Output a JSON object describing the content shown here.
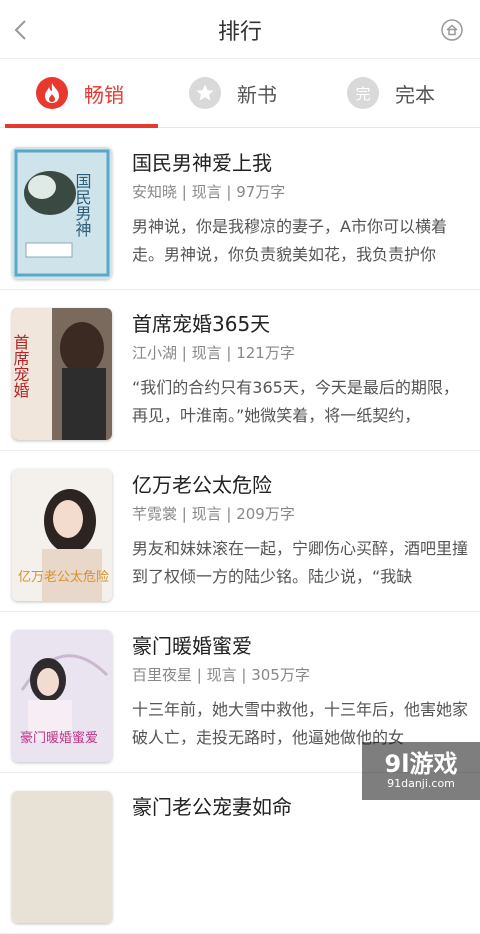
{
  "header": {
    "title": "排行"
  },
  "tabs": [
    {
      "label": "畅销",
      "icon": "flame-icon",
      "active": true,
      "badge": ""
    },
    {
      "label": "新书",
      "icon": "star-icon",
      "active": false,
      "badge": ""
    },
    {
      "label": "完本",
      "icon": "finished-icon",
      "active": false,
      "badge": "完"
    }
  ],
  "books": [
    {
      "title": "国民男神爱上我",
      "author": "安知晓",
      "category": "现言",
      "words": "97万字",
      "description": "男神说，你是我穆凉的妻子，A市你可以横着走。男神说，你负责貌美如花，我负责护你",
      "cover_text": "国民男神"
    },
    {
      "title": "首席宠婚365天",
      "author": "江小湖",
      "category": "现言",
      "words": "121万字",
      "description": "“我们的合约只有365天，今天是最后的期限，再见，叶淮南。”她微笑着，将一纸契约，",
      "cover_text": "首席宠婚"
    },
    {
      "title": "亿万老公太危险",
      "author": "芊霓裳",
      "category": "现言",
      "words": "209万字",
      "description": "男友和妹妹滚在一起，宁卿伤心买醉，酒吧里撞到了权倾一方的陆少铭。陆少说，“我缺",
      "cover_text": "亿万老公太危险"
    },
    {
      "title": "豪门暖婚蜜爱",
      "author": "百里夜星",
      "category": "现言",
      "words": "305万字",
      "description": "十三年前，她大雪中救他，十三年后，他害她家破人亡，走投无路时，他逼她做他的女",
      "cover_text": "豪门暖婚蜜爱"
    },
    {
      "title": "豪门老公宠妻如命",
      "author": "",
      "category": "",
      "words": "",
      "description": "",
      "cover_text": ""
    }
  ],
  "watermark": {
    "logo": "9l游戏",
    "url": "91danji.com"
  },
  "colors": {
    "accent": "#e8392f",
    "meta": "#888888",
    "divider": "#ececec"
  }
}
